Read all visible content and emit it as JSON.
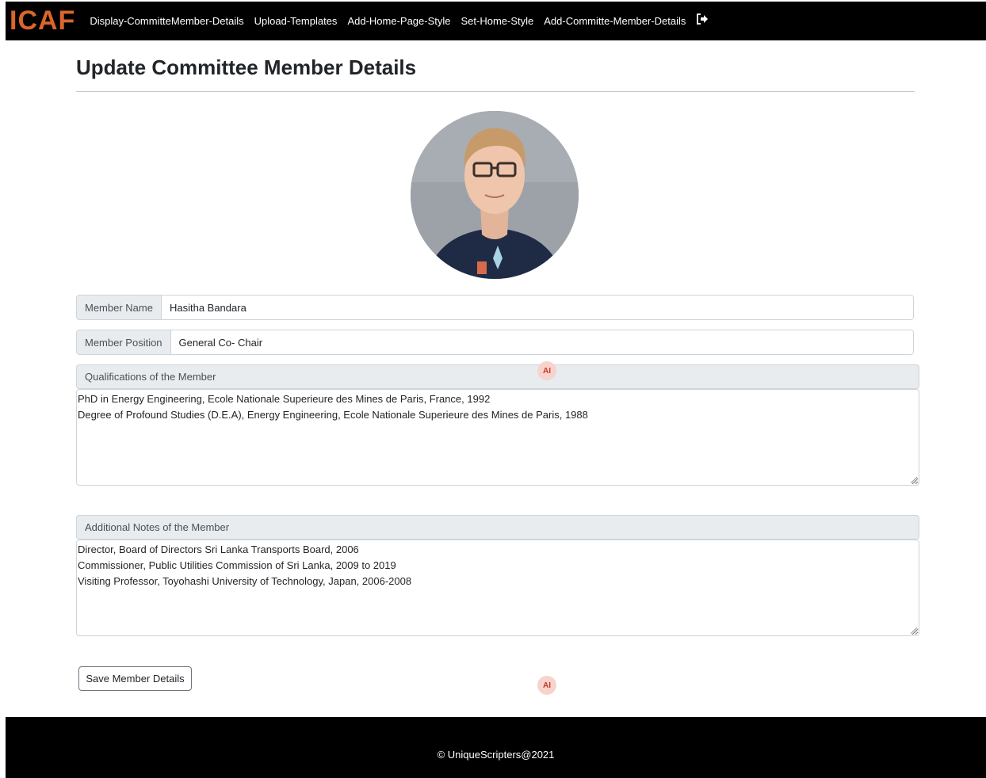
{
  "brand": {
    "logo_text": "ICAF",
    "accent": "#d9662b"
  },
  "nav": {
    "items": [
      {
        "label": "Display-CommitteMember-Details"
      },
      {
        "label": "Upload-Templates"
      },
      {
        "label": "Add-Home-Page-Style"
      },
      {
        "label": "Set-Home-Style"
      },
      {
        "label": "Add-Committe-Member-Details"
      }
    ],
    "logout_icon": "sign-out-icon"
  },
  "page": {
    "title": "Update Committee Member Details"
  },
  "member": {
    "photo_icon": "member-avatar-photo",
    "name_label": "Member Name",
    "name_value": "Hasitha Bandara",
    "position_label": "Member Position",
    "position_value": "General Co- Chair"
  },
  "qualifications": {
    "header": "Qualifications of the Member",
    "lines": [
      "PhD in Energy Engineering, Ecole Nationale Superieure des Mines de Paris, France, 1992",
      "Degree of Profound Studies (D.E.A), Energy Engineering, Ecole Nationale Superieure des Mines de Paris, 1988"
    ]
  },
  "notes": {
    "header": "Additional Notes of the Member",
    "lines": [
      "Director, Board of Directors Sri Lanka Transports Board, 2006",
      "Commissioner, Public Utilities Commission of Sri Lanka, 2009 to 2019",
      "Visiting Professor, Toyohashi University of Technology, Japan, 2006-2008"
    ]
  },
  "ai_badges": [
    "AI",
    "AI"
  ],
  "actions": {
    "save_label": "Save Member Details"
  },
  "footer": {
    "text": "© UniqueScripters@2021"
  }
}
